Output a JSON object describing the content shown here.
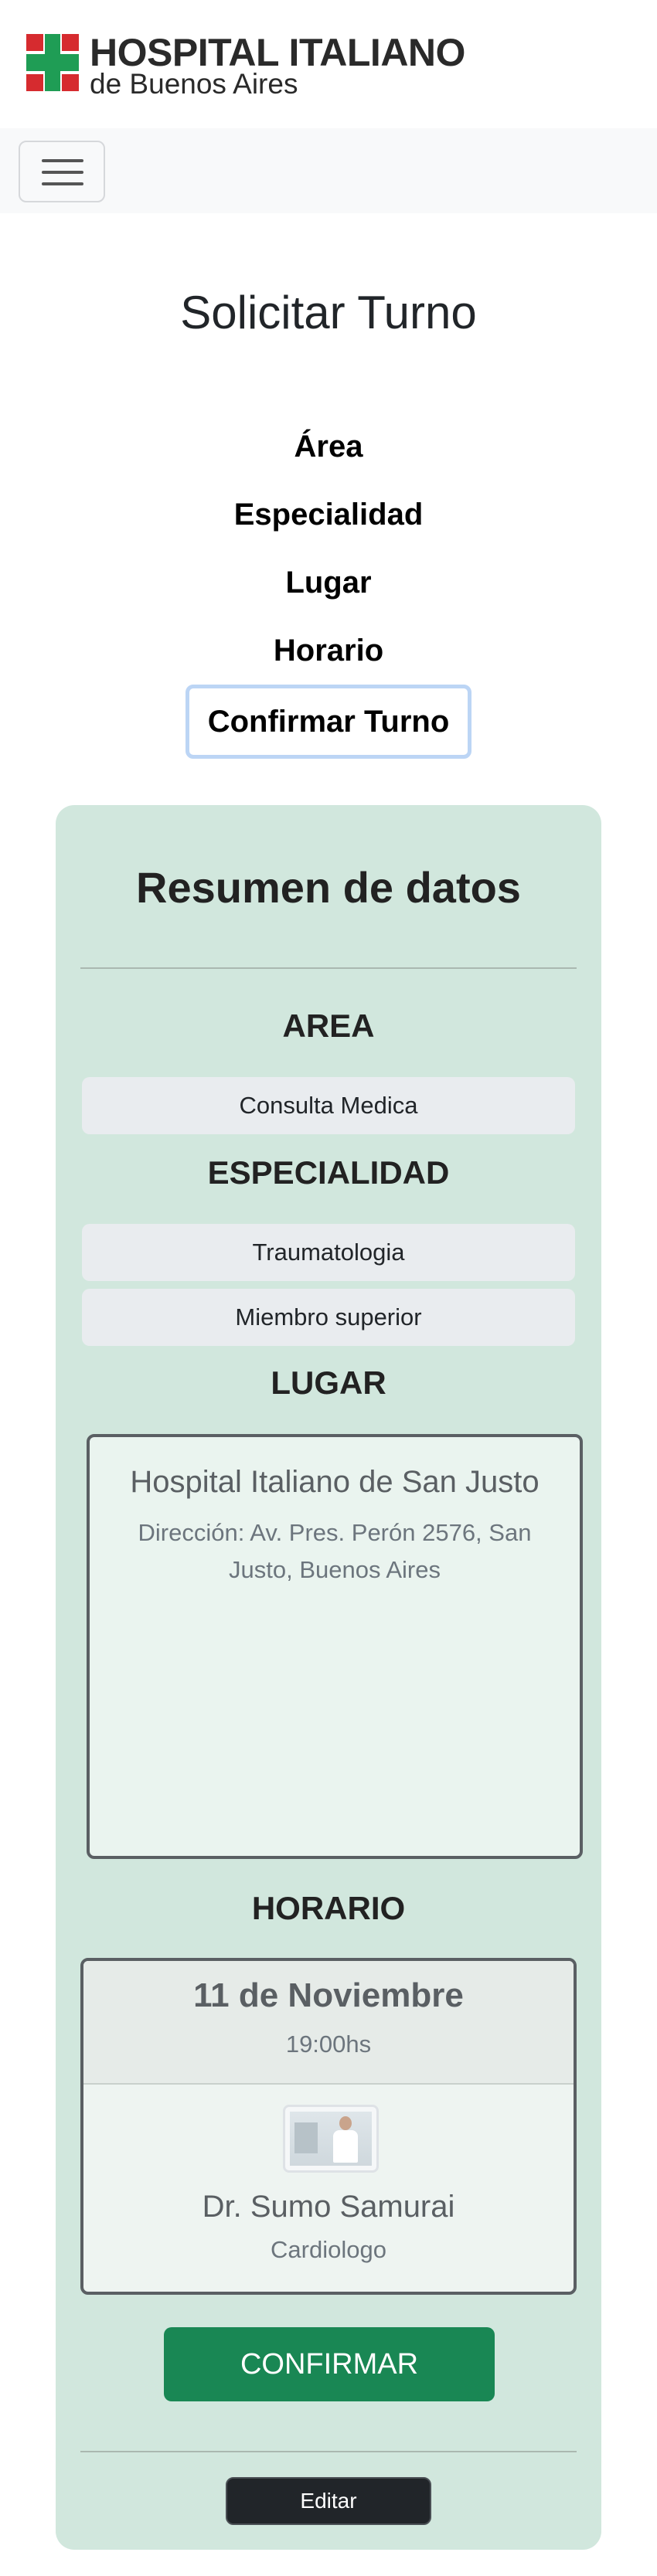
{
  "header": {
    "logo_line1": "HOSPITAL ITALIANO",
    "logo_line2": "de Buenos Aires",
    "logo_icon": "hospital-cross-logo",
    "menu_icon": "hamburger-menu-icon"
  },
  "page": {
    "title": "Solicitar Turno"
  },
  "steps": [
    {
      "label": "Área"
    },
    {
      "label": "Especialidad"
    },
    {
      "label": "Lugar"
    },
    {
      "label": "Horario"
    },
    {
      "label": "Confirmar Turno",
      "active": true
    }
  ],
  "summary": {
    "title": "Resumen de datos",
    "area": {
      "heading": "AREA",
      "value": "Consulta Medica"
    },
    "especialidad": {
      "heading": "ESPECIALIDAD",
      "values": [
        "Traumatologia",
        "Miembro superior"
      ]
    },
    "lugar": {
      "heading": "LUGAR",
      "name": "Hospital Italiano de San Justo",
      "address": "Dirección: Av. Pres. Perón 2576, San Justo, Buenos Aires"
    },
    "horario": {
      "heading": "HORARIO",
      "date": "11 de Noviembre",
      "time": "19:00hs",
      "doctor_name": "Dr. Sumo Samurai",
      "doctor_specialty": "Cardiologo"
    },
    "confirm_label": "CONFIRMAR",
    "edit_label": "Editar"
  },
  "colors": {
    "card_bg": "#d1e7dd",
    "confirm_bg": "#198754",
    "edit_bg": "#212529",
    "logo_red": "#d62b2f",
    "logo_green": "#1f9d55"
  }
}
